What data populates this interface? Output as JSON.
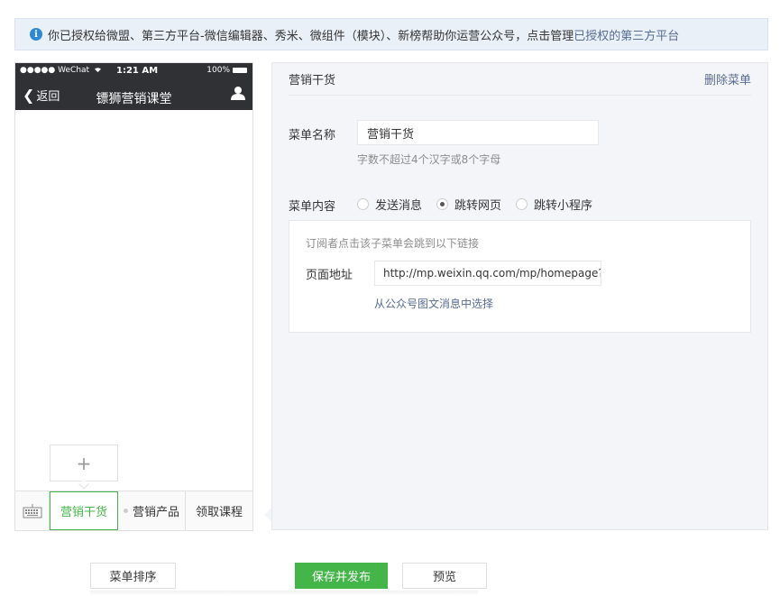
{
  "notice": {
    "text": "你已授权给微盟、第三方平台-微信编辑器、秀米、微组件（模块）、新榜帮助你运营公众号，点击管理",
    "link": "已授权的第三方平台"
  },
  "phone": {
    "status_left": "●●●●● WeChat",
    "status_time": "1:21 AM",
    "status_right": "100%",
    "back_label": "返回",
    "title": "镖狮营销课堂",
    "add_symbol": "+",
    "menu": [
      {
        "label": "营销干货",
        "active": true
      },
      {
        "label": "营销产品",
        "active": false
      },
      {
        "label": "领取课程",
        "active": false
      }
    ]
  },
  "editor": {
    "title": "营销干货",
    "delete_label": "删除菜单",
    "name_label": "菜单名称",
    "name_value": "营销干货",
    "name_hint": "字数不超过4个汉字或8个字母",
    "content_label": "菜单内容",
    "options": [
      {
        "label": "发送消息",
        "checked": false
      },
      {
        "label": "跳转网页",
        "checked": true
      },
      {
        "label": "跳转小程序",
        "checked": false
      }
    ],
    "box": {
      "hint": "订阅者点击该子菜单会跳到以下链接",
      "url_label": "页面地址",
      "url_value": "http://mp.weixin.qq.com/mp/homepage?",
      "choose_link": "从公众号图文消息中选择"
    }
  },
  "buttons": {
    "sort": "菜单排序",
    "save": "保存并发布",
    "preview": "预览"
  },
  "colors": {
    "accent": "#44b549",
    "link": "#576b95",
    "info": "#2f88d4",
    "header": "#2f3134"
  }
}
